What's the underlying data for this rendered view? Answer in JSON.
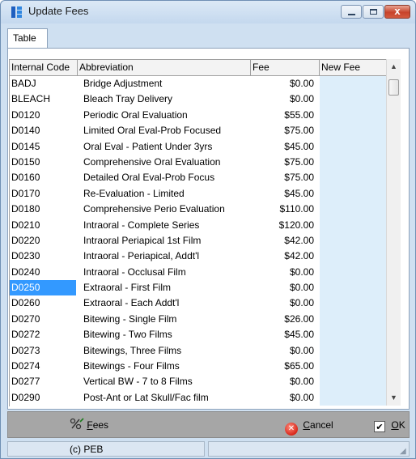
{
  "window": {
    "title": "Update Fees",
    "close_symbol": "x"
  },
  "tabs": [
    "Table"
  ],
  "table": {
    "headers": {
      "code": "Internal Code",
      "abbr": "Abbreviation",
      "fee": "Fee",
      "new_fee": "New Fee"
    },
    "selected_row": 13,
    "rows": [
      {
        "code": "BADJ",
        "abbr": "Bridge Adjustment",
        "fee": "$0.00",
        "new_fee": ""
      },
      {
        "code": "BLEACH",
        "abbr": "Bleach Tray Delivery",
        "fee": "$0.00",
        "new_fee": ""
      },
      {
        "code": "D0120",
        "abbr": "Periodic Oral Evaluation",
        "fee": "$55.00",
        "new_fee": ""
      },
      {
        "code": "D0140",
        "abbr": "Limited Oral Eval-Prob Focused",
        "fee": "$75.00",
        "new_fee": ""
      },
      {
        "code": "D0145",
        "abbr": "Oral Eval - Patient Under 3yrs",
        "fee": "$45.00",
        "new_fee": ""
      },
      {
        "code": "D0150",
        "abbr": "Comprehensive Oral Evaluation",
        "fee": "$75.00",
        "new_fee": ""
      },
      {
        "code": "D0160",
        "abbr": "Detailed Oral Eval-Prob Focus",
        "fee": "$75.00",
        "new_fee": ""
      },
      {
        "code": "D0170",
        "abbr": "Re-Evaluation - Limited",
        "fee": "$45.00",
        "new_fee": ""
      },
      {
        "code": "D0180",
        "abbr": "Comprehensive Perio Evaluation",
        "fee": "$110.00",
        "new_fee": ""
      },
      {
        "code": "D0210",
        "abbr": "Intraoral - Complete Series",
        "fee": "$120.00",
        "new_fee": ""
      },
      {
        "code": "D0220",
        "abbr": "Intraoral Periapical 1st Film",
        "fee": "$42.00",
        "new_fee": ""
      },
      {
        "code": "D0230",
        "abbr": "Intraoral - Periapical, Addt'l",
        "fee": "$42.00",
        "new_fee": ""
      },
      {
        "code": "D0240",
        "abbr": "Intraoral - Occlusal Film",
        "fee": "$0.00",
        "new_fee": ""
      },
      {
        "code": "D0250",
        "abbr": "Extraoral - First Film",
        "fee": "$0.00",
        "new_fee": ""
      },
      {
        "code": "D0260",
        "abbr": "Extraoral - Each Addt'l",
        "fee": "$0.00",
        "new_fee": ""
      },
      {
        "code": "D0270",
        "abbr": "Bitewing - Single Film",
        "fee": "$26.00",
        "new_fee": ""
      },
      {
        "code": "D0272",
        "abbr": "Bitewing - Two Films",
        "fee": "$45.00",
        "new_fee": ""
      },
      {
        "code": "D0273",
        "abbr": "Bitewings, Three Films",
        "fee": "$0.00",
        "new_fee": ""
      },
      {
        "code": "D0274",
        "abbr": "Bitewings - Four Films",
        "fee": "$65.00",
        "new_fee": ""
      },
      {
        "code": "D0277",
        "abbr": "Vertical BW - 7 to 8 Films",
        "fee": "$0.00",
        "new_fee": ""
      },
      {
        "code": "D0290",
        "abbr": "Post-Ant or Lat Skull/Fac film",
        "fee": "$0.00",
        "new_fee": ""
      }
    ]
  },
  "buttons": {
    "fees_mnemonic": "F",
    "fees_rest": "ees",
    "cancel_mnemonic": "C",
    "cancel_rest": "ancel",
    "ok_mnemonic": "O",
    "ok_rest": "K",
    "ok_checked": true,
    "check_symbol": "✔",
    "cancel_symbol": "✕"
  },
  "status": {
    "left": "(c) PEB",
    "right": ""
  },
  "icons": {
    "app": "app-icon",
    "minimize": "minimize-icon",
    "maximize": "maximize-icon",
    "close": "close-icon",
    "fees": "percent-edit-icon",
    "cancel": "cancel-icon",
    "ok": "checkbox-icon",
    "scroll_up": "scroll-up-icon",
    "scroll_down": "scroll-down-icon",
    "grip": "resize-grip-icon"
  },
  "colors": {
    "selection": "#3399ff",
    "new_fee_column": "#ddeefa",
    "close_button": "#c7432a"
  }
}
